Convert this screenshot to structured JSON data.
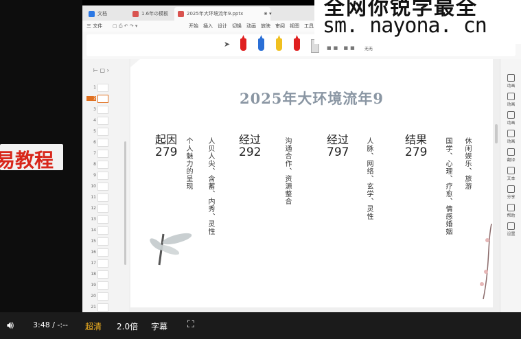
{
  "watermark": {
    "top_text": "全网你锐学最全",
    "url": "sm. nayona. cn"
  },
  "left_banner": {
    "text": "易教程"
  },
  "tabs": [
    {
      "label": "文档",
      "color": "#2b78e4"
    },
    {
      "label": "1.6年の模板",
      "color": "#d9534f"
    },
    {
      "label": "2025年大环境流年9.pptx",
      "color": "#d9534f"
    }
  ],
  "menubar": {
    "file": "三 文件",
    "items": [
      "开始",
      "插入",
      "设计",
      "切换",
      "动画",
      "放映",
      "审阅",
      "视图",
      "工具"
    ]
  },
  "ribbon": {
    "zoom_label": "无无",
    "pen_colors": [
      "#e02020",
      "#2a6fd6",
      "#f0c020",
      "#e02020"
    ]
  },
  "thumbnails": {
    "numbers": [
      "1",
      "2",
      "3",
      "4",
      "5",
      "6",
      "7",
      "8",
      "9",
      "10",
      "11",
      "12",
      "13",
      "14",
      "15",
      "16",
      "17",
      "18",
      "19",
      "20",
      "21"
    ],
    "selected": "2"
  },
  "slide": {
    "title": "2025年大环境流年9",
    "columns": [
      {
        "heading": "起因",
        "number": "279",
        "texts": [
          "个人魅力的呈现",
          "人贝人尖、含蓄、内秀、灵性"
        ]
      },
      {
        "heading": "经过",
        "number": "292",
        "texts": [
          "沟通合作、资源整合"
        ]
      },
      {
        "heading": "经过",
        "number": "797",
        "texts": [
          "人脉、网络、玄学、灵性"
        ]
      },
      {
        "heading": "结果",
        "number": "279",
        "texts": [
          "国学、心理、疗愈、情感婚姻",
          "休闲娱乐、旅游"
        ]
      }
    ]
  },
  "rightbar": {
    "items": [
      "动画",
      "动画",
      "动画",
      "动画",
      "翻译",
      "文本",
      "分享",
      "帮助",
      "设置"
    ]
  },
  "videobar": {
    "time": "3:48 / -:--",
    "quality": "超清",
    "speed": "2.0倍",
    "subtitle": "字幕"
  }
}
